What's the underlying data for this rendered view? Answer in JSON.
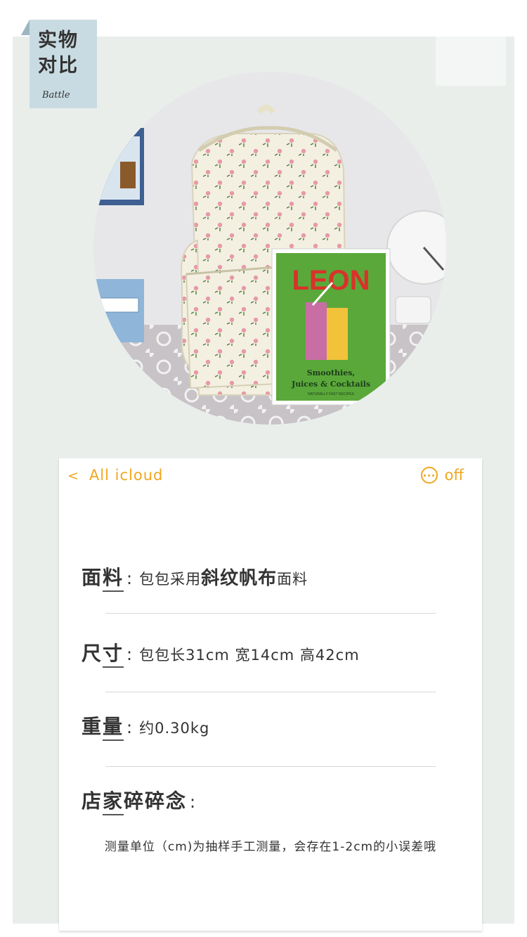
{
  "tag": {
    "title": "实物对比",
    "subtitle": "Battle"
  },
  "photo": {
    "book": {
      "title": "LEON",
      "subtitle": "Smoothies, Juices & Cocktails",
      "caption": "NATURALLY FAST RECIPES"
    }
  },
  "card": {
    "nav": {
      "back_label": "All icloud",
      "more_label": "off"
    },
    "rows": [
      {
        "label_a": "面",
        "label_b": "料",
        "value_1": "包包采用",
        "value_2": "斜纹帆布",
        "value_3": "面料"
      },
      {
        "label_a": "尺",
        "label_b": "寸",
        "value_1": "包包长31cm  宽14cm  高42cm"
      },
      {
        "label_a": "重",
        "label_b": "量",
        "value_1": "约0.30kg"
      },
      {
        "label_a": "店",
        "label_b": "家",
        "label_c": "碎碎念"
      }
    ],
    "note": "测量单位（cm)为抽样手工测量，会存在1-2cm的小误差哦"
  },
  "colors": {
    "accent": "#f0a71f",
    "tag_bg": "#c9dbe2",
    "panel_bg": "#e9eeeb",
    "book_green": "#5aa83a"
  }
}
